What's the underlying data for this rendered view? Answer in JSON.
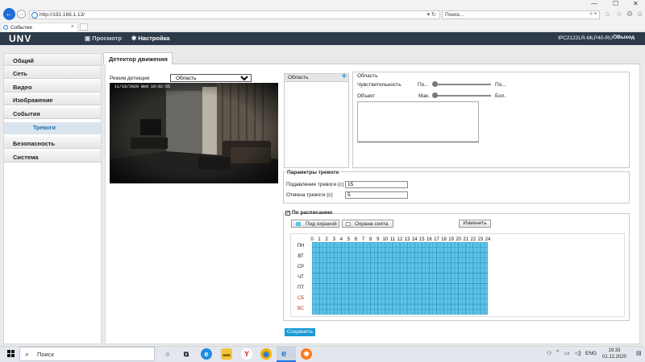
{
  "browser": {
    "address": "http://192.168.1.13/",
    "search_placeholder": "Поиск...",
    "tab_title": "События",
    "address_controls": "▾ ↻",
    "search_icon": "search-icon"
  },
  "header": {
    "logo": "UNV",
    "nav": [
      {
        "label": "Просмотр",
        "icon": "monitor-icon"
      },
      {
        "label": "Настройка",
        "icon": "gear-icon"
      }
    ],
    "device": "IPC2122LR-MLP40-RU",
    "logout": "Выход"
  },
  "sidebar": {
    "items": [
      "Общий",
      "Сеть",
      "Видео",
      "Изображение",
      "События"
    ],
    "subitem": "Тревоги",
    "items_after": [
      "Безопасность",
      "Система"
    ]
  },
  "page": {
    "tab": "Детектор движения",
    "detection_mode_label": "Режим детекции",
    "detection_mode_value": "Область",
    "camera_osd": "11/18/2020 Wed 10:02:55",
    "area_list_header": "Область",
    "area_panel": {
      "title": "Область",
      "sensitivity_label": "Чувствительность",
      "sensitivity_min": "По...",
      "sensitivity_max": "По...",
      "sensitivity_level": 0.02,
      "object_label": "Объект",
      "object_min": "Мак.",
      "object_max": "Бол.",
      "object_level": 0.02
    },
    "alarm_params": {
      "title": "Параметры тревоги",
      "suppression_label": "Подавление тревоги (с)",
      "suppression_value": "15",
      "cancel_label": "Отмена тревоги (с)",
      "cancel_value": "5"
    },
    "schedule": {
      "checkbox_label": "По расписанию",
      "armed_label": "Под охраной",
      "disarmed_label": "Охрана снята",
      "edit_button": "Изменить",
      "hours": [
        "0",
        "1",
        "2",
        "3",
        "4",
        "5",
        "6",
        "7",
        "8",
        "9",
        "10",
        "11",
        "12",
        "13",
        "14",
        "15",
        "16",
        "17",
        "18",
        "19",
        "20",
        "21",
        "22",
        "23",
        "24"
      ],
      "days": [
        "ПН",
        "ВТ",
        "СР",
        "ЧТ",
        "ПТ",
        "СБ",
        "ВС"
      ],
      "armed_color": "#5cc3e8"
    },
    "save_button": "Сохранить"
  },
  "taskbar": {
    "search": "Поиск",
    "lang": "ENG",
    "time": "19:33",
    "date": "01.12.2020"
  }
}
